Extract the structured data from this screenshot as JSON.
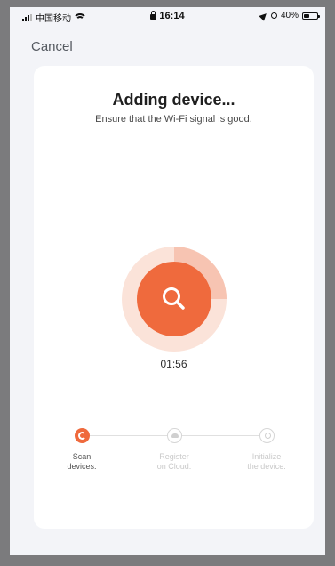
{
  "status_bar": {
    "carrier": "中国移动",
    "time": "16:14",
    "battery": "40%",
    "battery_level": 0.4
  },
  "header": {
    "cancel_label": "Cancel"
  },
  "card": {
    "title": "Adding device...",
    "subtitle": "Ensure that the Wi-Fi signal is good.",
    "timer": "01:56",
    "progress_fraction": 0.25
  },
  "steps": [
    {
      "line1": "Scan",
      "line2": "devices.",
      "state": "active",
      "icon": "scan-icon"
    },
    {
      "line1": "Register",
      "line2": "on Cloud.",
      "state": "pending",
      "icon": "cloud-icon"
    },
    {
      "line1": "Initialize",
      "line2": "the device.",
      "state": "pending",
      "icon": "initialize-icon"
    }
  ],
  "colors": {
    "accent": "#ef6a3d",
    "accent_light": "#f7c4b2",
    "accent_pale": "#fbe3d9"
  }
}
